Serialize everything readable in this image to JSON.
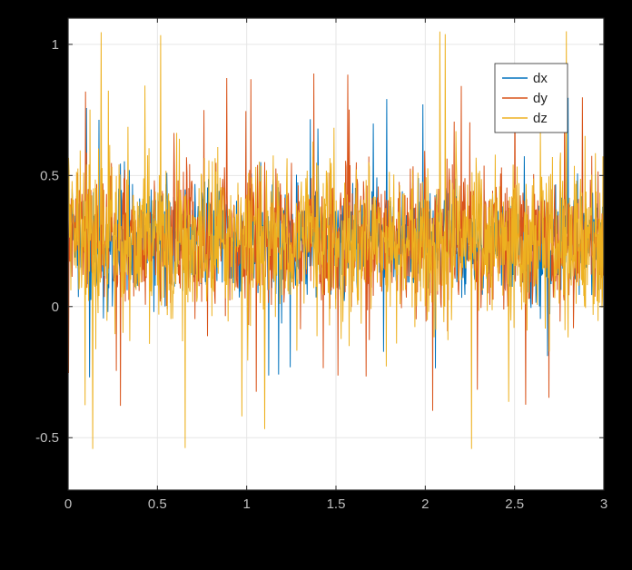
{
  "chart_data": {
    "type": "line",
    "x": [
      0,
      0.5,
      1,
      1.5,
      2,
      2.5,
      3
    ],
    "x_ticks": [
      0,
      0.5,
      1,
      1.5,
      2,
      2.5,
      3
    ],
    "y_ticks": [
      -0.5,
      0,
      0.5,
      1
    ],
    "xlabel": "",
    "ylabel": "",
    "title": "",
    "xlim": [
      0,
      3
    ],
    "ylim": [
      -0.7,
      1.1
    ],
    "grid": true,
    "n_points": 1200,
    "note": "Dense noise traces; values are approximate envelopes read from pixels. Individual sample values not legible; summary stats per series below.",
    "series": [
      {
        "name": "dx",
        "color": "#0072BD",
        "approx_mean": 0.25,
        "approx_std": 0.15,
        "approx_min": -0.3,
        "approx_max": 0.8
      },
      {
        "name": "dy",
        "color": "#D95319",
        "approx_mean": 0.25,
        "approx_std": 0.18,
        "approx_min": -0.4,
        "approx_max": 0.9
      },
      {
        "name": "dz",
        "color": "#EDB120",
        "approx_mean": 0.25,
        "approx_std": 0.22,
        "approx_min": -0.55,
        "approx_max": 1.05
      }
    ],
    "legend": {
      "position": "northeast",
      "entries": [
        "dx",
        "dy",
        "dz"
      ]
    }
  },
  "tick_labels": {
    "x": [
      "0",
      "0.5",
      "1",
      "1.5",
      "2",
      "2.5",
      "3"
    ],
    "y": [
      "-0.5",
      "0",
      "0.5",
      "1"
    ]
  }
}
